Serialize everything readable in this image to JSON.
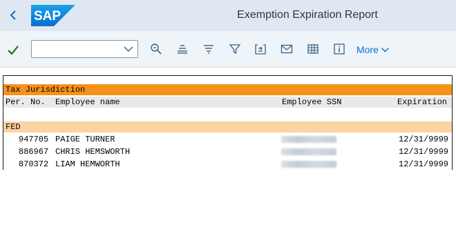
{
  "header": {
    "logo_text": "SAP",
    "title": "Exemption Expiration Report",
    "colors": {
      "bar": "#dfe8f1",
      "logo_blue": "#0a6ed1"
    }
  },
  "toolbar": {
    "select_value": "",
    "more_label": "More",
    "icons": [
      "checkmark-icon",
      "search-icon",
      "align-center-icon",
      "sort-icon",
      "filter-icon",
      "export-icon",
      "mail-icon",
      "spreadsheet-icon",
      "info-icon",
      "chevron-down-icon"
    ]
  },
  "report": {
    "group_header": "Tax Jurisdiction",
    "columns": {
      "pernr": "Per. No.",
      "name": "Employee name",
      "ssn": "Employee SSN",
      "expiration": "Expiration"
    },
    "group": "FED",
    "rows": [
      {
        "pernr": "947705",
        "name": "PAIGE TURNER",
        "expiration": "12/31/9999"
      },
      {
        "pernr": "886967",
        "name": "CHRIS HEMSWORTH",
        "expiration": "12/31/9999"
      },
      {
        "pernr": "870372",
        "name": "LIAM HEMWORTH",
        "expiration": "12/31/9999"
      }
    ],
    "colors": {
      "group_header_bg": "#f5921b",
      "column_header_bg": "#e7e9ea",
      "group_bg": "#fcd3a3"
    }
  }
}
